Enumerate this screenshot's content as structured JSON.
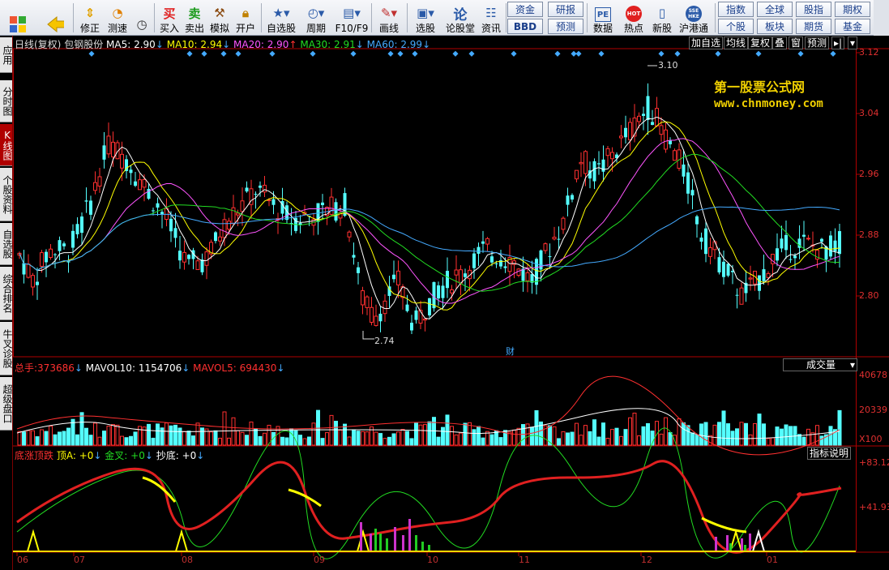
{
  "toolbar": {
    "buttons": [
      {
        "label": "修正",
        "icon": "up-down-arrows-icon"
      },
      {
        "label": "测速",
        "icon": "speed-dial-icon"
      },
      {
        "label": "买入",
        "icon": "buy-icon",
        "glyph": "买"
      },
      {
        "label": "卖出",
        "icon": "sell-icon",
        "glyph": "卖"
      },
      {
        "label": "模拟",
        "icon": "hammer-icon"
      },
      {
        "label": "开户",
        "icon": "lock-icon"
      },
      {
        "label": "自选股",
        "icon": "star-list-icon"
      },
      {
        "label": "周期",
        "icon": "clock-icon"
      },
      {
        "label": "F10/F9",
        "icon": "document-icon"
      },
      {
        "label": "画线",
        "icon": "pencil-icon"
      },
      {
        "label": "选股",
        "icon": "filter-icon"
      },
      {
        "label": "论股堂",
        "icon": "discuss-icon",
        "glyph": "论"
      },
      {
        "label": "资讯",
        "icon": "news-icon"
      },
      {
        "label": "数据",
        "icon": "pe-icon",
        "glyph": "PE"
      },
      {
        "label": "热点",
        "icon": "hot-icon",
        "glyph": "HOT"
      },
      {
        "label": "新股",
        "icon": "ipo-icon"
      },
      {
        "label": "沪港通",
        "icon": "hk-connect-icon",
        "glyph": "SSE HKE"
      }
    ],
    "small_buttons": [
      "资金",
      "研报",
      "BBD",
      "预测",
      "指数",
      "全球",
      "股指",
      "期权",
      "个股",
      "板块",
      "期货",
      "基金"
    ]
  },
  "left_tabs": [
    {
      "label": "应用",
      "active": false
    },
    {
      "label": "分时图",
      "active": false
    },
    {
      "label": "K线图",
      "active": true
    },
    {
      "label": "个股资料",
      "active": false
    },
    {
      "label": "自选股",
      "active": false
    },
    {
      "label": "综合排名",
      "active": false
    },
    {
      "label": "牛叉诊股",
      "active": false
    },
    {
      "label": "超级盘口",
      "active": false
    }
  ],
  "header": {
    "period": "日线(复权)",
    "stock": "包钢股份",
    "ma": [
      {
        "text": "MA5: 2.90",
        "arrow": "↓",
        "color": "#ffffff"
      },
      {
        "text": "MA10: 2.94",
        "arrow": "↓",
        "color": "#ffff00"
      },
      {
        "text": "MA20: 2.90",
        "arrow": "↑",
        "color": "#ff55ff"
      },
      {
        "text": "MA30: 2.91",
        "arrow": "↓",
        "color": "#22dd22"
      },
      {
        "text": "MA60: 2.99",
        "arrow": "↓",
        "color": "#44aaff"
      }
    ],
    "right_buttons": [
      "加自选",
      "均线",
      "复权",
      "叠",
      "窗",
      "预测"
    ]
  },
  "watermark": {
    "line1": "第一股票公式网",
    "line2": "www.chnmoney.com"
  },
  "price_axis": [
    "3.12",
    "3.04",
    "2.96",
    "2.88",
    "2.80"
  ],
  "annotations": {
    "high": "3.10",
    "low": "2.74",
    "marker": "财"
  },
  "volume": {
    "label": "总手:",
    "value": "373686",
    "arrow": "↓",
    "mavol10_label": "MAVOL10:",
    "mavol10": "1154706",
    "mavol10_arrow": "↓",
    "mavol5_label": "MAVOL5:",
    "mavol5": "694430",
    "mavol5_arrow": "↓",
    "selector": "成交量",
    "axis": [
      "40678",
      "20339",
      "X100"
    ]
  },
  "indicator": {
    "name": "底涨顶跌",
    "parts": [
      {
        "text": "顶A: +0",
        "arrow": "↓",
        "color": "#ffff00"
      },
      {
        "text": "金叉: +0",
        "arrow": "↓",
        "color": "#22dd22"
      },
      {
        "text": "抄底: +0",
        "arrow": "↓",
        "color": "#ffffff"
      }
    ],
    "help": "指标说明",
    "axis": [
      "+83.12",
      "+41.93"
    ]
  },
  "x_labels": [
    "06",
    "07",
    "08",
    "09",
    "10",
    "11",
    "12",
    "01"
  ],
  "colors": {
    "up": "#ff3030",
    "down": "#54ffff",
    "axis_border": "#b00000",
    "ma5": "#ffffff",
    "ma10": "#ffff00",
    "ma20": "#ff55ff",
    "ma30": "#22dd22",
    "ma60": "#44aaff"
  }
}
